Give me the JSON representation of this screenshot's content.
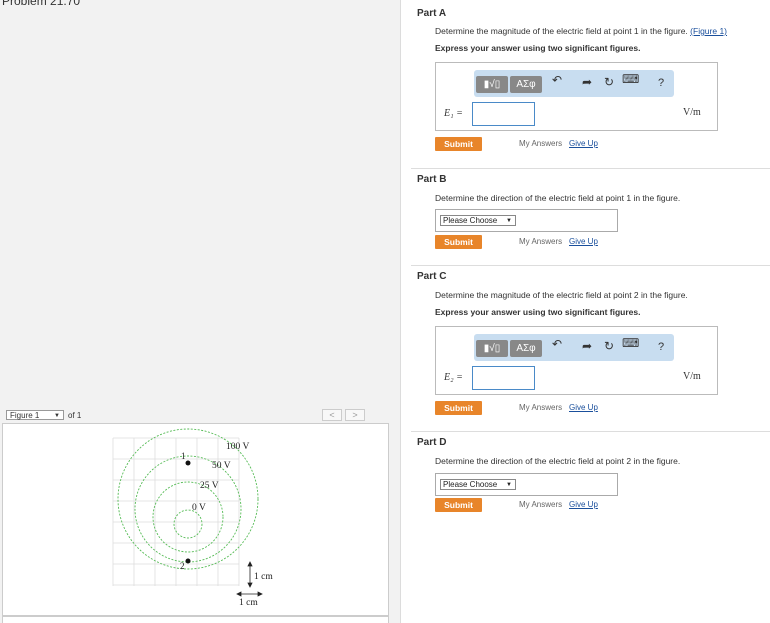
{
  "problem_title": "Problem 21.70",
  "figure_nav": {
    "selected": "Figure 1",
    "of_label": "of 1",
    "prev_label": "<",
    "next_label": ">"
  },
  "figure": {
    "labels": {
      "v100": "100 V",
      "v50": "50 V",
      "v25": "25 V",
      "v0": "0 V",
      "p1": "1",
      "p2": "2",
      "scale_v": "1 cm",
      "scale_h": "1 cm"
    },
    "colors": {
      "equipotential": "#55bb55",
      "grid": "#dddddd"
    }
  },
  "parts": {
    "a": {
      "label": "Part A",
      "question": "Determine the magnitude of the electric field at point 1 in the figure.",
      "figure_link": "(Figure 1)",
      "instruction": "Express your answer using two significant figures.",
      "var_label": "E₁ =",
      "unit": "V/m",
      "value": ""
    },
    "b": {
      "label": "Part B",
      "question": "Determine the direction of the electric field at point 1 in the figure.",
      "dropdown": "Please Choose"
    },
    "c": {
      "label": "Part C",
      "question": "Determine the magnitude of the electric field at point 2 in the figure.",
      "instruction": "Express your answer using two significant figures.",
      "var_label": "E₂ =",
      "unit": "V/m",
      "value": ""
    },
    "d": {
      "label": "Part D",
      "question": "Determine the direction of the electric field at point 2 in the figure.",
      "dropdown": "Please Choose"
    }
  },
  "toolbar": {
    "template_label": "▮√▯",
    "greek_label": "ΑΣφ",
    "undo": "↶",
    "redo": "➦",
    "reset": "↻",
    "keyboard": "⌨",
    "help": "?"
  },
  "actions": {
    "submit": "Submit",
    "my_answers": "My Answers",
    "give_up": "Give Up"
  },
  "colors": {
    "submit": "#e8852a",
    "link": "#1a4f9c",
    "toolbar": "#c8ddf0"
  }
}
